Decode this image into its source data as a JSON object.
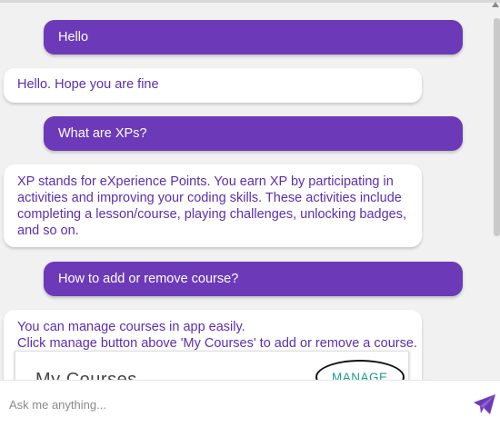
{
  "messages": [
    {
      "role": "user",
      "text": "Hello"
    },
    {
      "role": "bot",
      "text": "Hello. Hope you are fine"
    },
    {
      "role": "user",
      "text": "What are XPs?"
    },
    {
      "role": "bot",
      "text": "XP stands for eXperience Points. You earn XP by participating in activities and improving your coding skills. These activities include completing a lesson/course, playing challenges, unlocking badges, and so on."
    },
    {
      "role": "user",
      "text": "How to add or remove course?"
    },
    {
      "role": "bot",
      "lines": [
        "You can manage courses in app easily.",
        "Click manage button above 'My Courses' to add or remove a course."
      ]
    }
  ],
  "screenshot_card": {
    "title": "My Courses",
    "manage_label": "MANAGE"
  },
  "composer": {
    "placeholder": "Ask me anything..."
  },
  "icons": {
    "send": "send-icon",
    "scroll_up": "chevron-up-icon"
  },
  "colors": {
    "user_bubble": "#6c3ab9",
    "bot_text": "#5a2fb0",
    "bot_bubble": "#ffffff",
    "background": "#f1f1f1",
    "send_icon": "#6c3ab9",
    "manage_text": "#1a9c8c"
  }
}
